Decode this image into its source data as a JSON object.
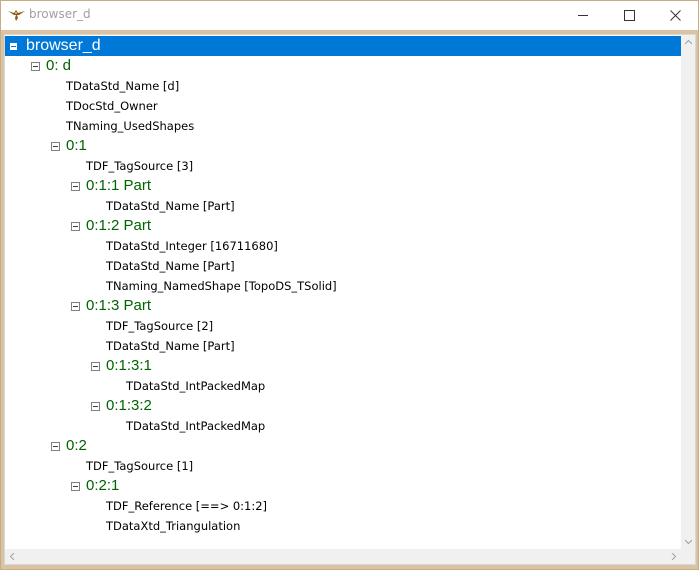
{
  "window": {
    "title": "browser_d",
    "app_icon": "eagle-icon",
    "controls": {
      "minimize": "minimize-icon",
      "maximize": "maximize-icon",
      "close": "close-icon"
    }
  },
  "tree": {
    "selected": "browser_d",
    "items": [
      {
        "label": "browser_d",
        "kind": "root",
        "expandable": true,
        "expanded": true
      },
      {
        "label": "0: d",
        "kind": "node",
        "expandable": true,
        "expanded": true
      },
      {
        "label": "TDataStd_Name [d]",
        "kind": "attr"
      },
      {
        "label": "TDocStd_Owner",
        "kind": "attr"
      },
      {
        "label": "TNaming_UsedShapes",
        "kind": "attr"
      },
      {
        "label": "0:1",
        "kind": "node",
        "expandable": true,
        "expanded": true
      },
      {
        "label": "TDF_TagSource [3]",
        "kind": "attr"
      },
      {
        "label": "0:1:1 Part",
        "kind": "node",
        "expandable": true,
        "expanded": true
      },
      {
        "label": "TDataStd_Name [Part]",
        "kind": "attr"
      },
      {
        "label": "0:1:2 Part",
        "kind": "node",
        "expandable": true,
        "expanded": true
      },
      {
        "label": "TDataStd_Integer [16711680]",
        "kind": "attr"
      },
      {
        "label": "TDataStd_Name [Part]",
        "kind": "attr"
      },
      {
        "label": "TNaming_NamedShape [TopoDS_TSolid]",
        "kind": "attr"
      },
      {
        "label": "0:1:3 Part",
        "kind": "node",
        "expandable": true,
        "expanded": true
      },
      {
        "label": "TDF_TagSource [2]",
        "kind": "attr"
      },
      {
        "label": "TDataStd_Name [Part]",
        "kind": "attr"
      },
      {
        "label": "0:1:3:1",
        "kind": "node",
        "expandable": true,
        "expanded": true
      },
      {
        "label": "TDataStd_IntPackedMap",
        "kind": "attr"
      },
      {
        "label": "0:1:3:2",
        "kind": "node",
        "expandable": true,
        "expanded": true
      },
      {
        "label": "TDataStd_IntPackedMap",
        "kind": "attr"
      },
      {
        "label": "0:2",
        "kind": "node",
        "expandable": true,
        "expanded": true
      },
      {
        "label": "TDF_TagSource [1]",
        "kind": "attr"
      },
      {
        "label": "0:2:1",
        "kind": "node",
        "expandable": true,
        "expanded": true
      },
      {
        "label": "TDF_Reference [==> 0:1:2]",
        "kind": "attr"
      },
      {
        "label": "TDataXtd_Triangulation",
        "kind": "attr"
      }
    ]
  },
  "colors": {
    "selection": "#0078d7",
    "node_text": "#006400",
    "attr_text": "#000000",
    "frame": "#d9c3a3"
  }
}
